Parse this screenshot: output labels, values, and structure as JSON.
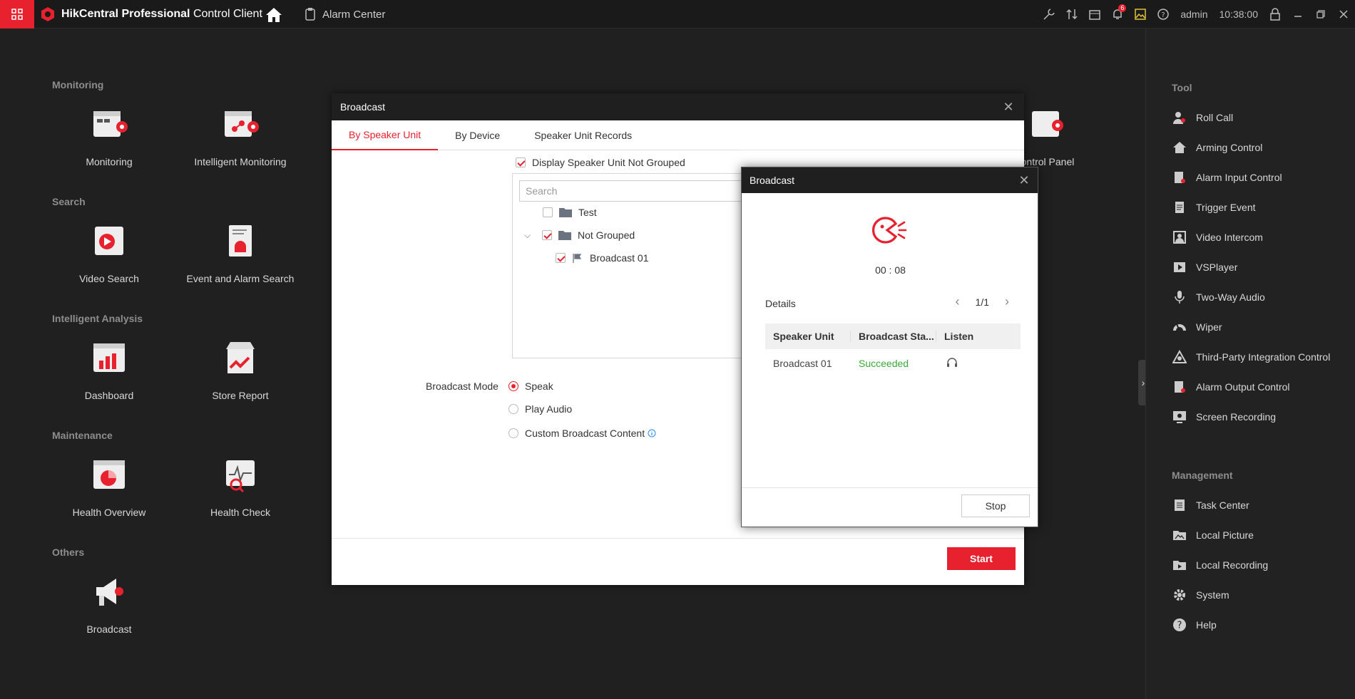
{
  "topbar": {
    "brand_bold": "HikCentral Professional",
    "brand_rest": "Control Client",
    "alarm_tab": "Alarm Center",
    "notification_count": "6",
    "user": "admin",
    "time": "10:38:00"
  },
  "sections": {
    "monitoring": "Monitoring",
    "search": "Search",
    "intelligent": "Intelligent Analysis",
    "maintenance": "Maintenance",
    "others": "Others"
  },
  "tiles": {
    "monitoring": "Monitoring",
    "intelligent_monitoring": "Intelligent Monitoring",
    "video_search": "Video Search",
    "event_alarm_search": "Event and Alarm Search",
    "dashboard": "Dashboard",
    "store_report": "Store Report",
    "health_overview": "Health Overview",
    "health_check": "Health Check",
    "broadcast": "Broadcast",
    "control_panel_partial": "ontrol Panel"
  },
  "right_panel": {
    "tool_title": "Tool",
    "tools": [
      "Roll Call",
      "Arming Control",
      "Alarm Input Control",
      "Trigger Event",
      "Video Intercom",
      "VSPlayer",
      "Two-Way Audio",
      "Wiper",
      "Third-Party Integration Control",
      "Alarm Output Control",
      "Screen Recording"
    ],
    "management_title": "Management",
    "management": [
      "Task Center",
      "Local Picture",
      "Local Recording",
      "System",
      "Help"
    ]
  },
  "dialog": {
    "title": "Broadcast",
    "tabs": [
      "By Speaker Unit",
      "By Device",
      "Speaker Unit Records"
    ],
    "display_not_grouped": "Display Speaker Unit Not Grouped",
    "search_placeholder": "Search",
    "tree": {
      "test": "Test",
      "not_grouped": "Not Grouped",
      "broadcast01": "Broadcast 01"
    },
    "mode_label": "Broadcast Mode",
    "modes": [
      "Speak",
      "Play Audio",
      "Custom Broadcast Content"
    ],
    "start": "Start"
  },
  "dialog2": {
    "title": "Broadcast",
    "timer": "00 : 08",
    "details": "Details",
    "page": "1/1",
    "columns": [
      "Speaker Unit",
      "Broadcast Sta...",
      "Listen"
    ],
    "row": {
      "unit": "Broadcast 01",
      "status": "Succeeded"
    },
    "stop": "Stop"
  },
  "colors": {
    "accent": "#e8212f",
    "success": "#3aa83a"
  }
}
